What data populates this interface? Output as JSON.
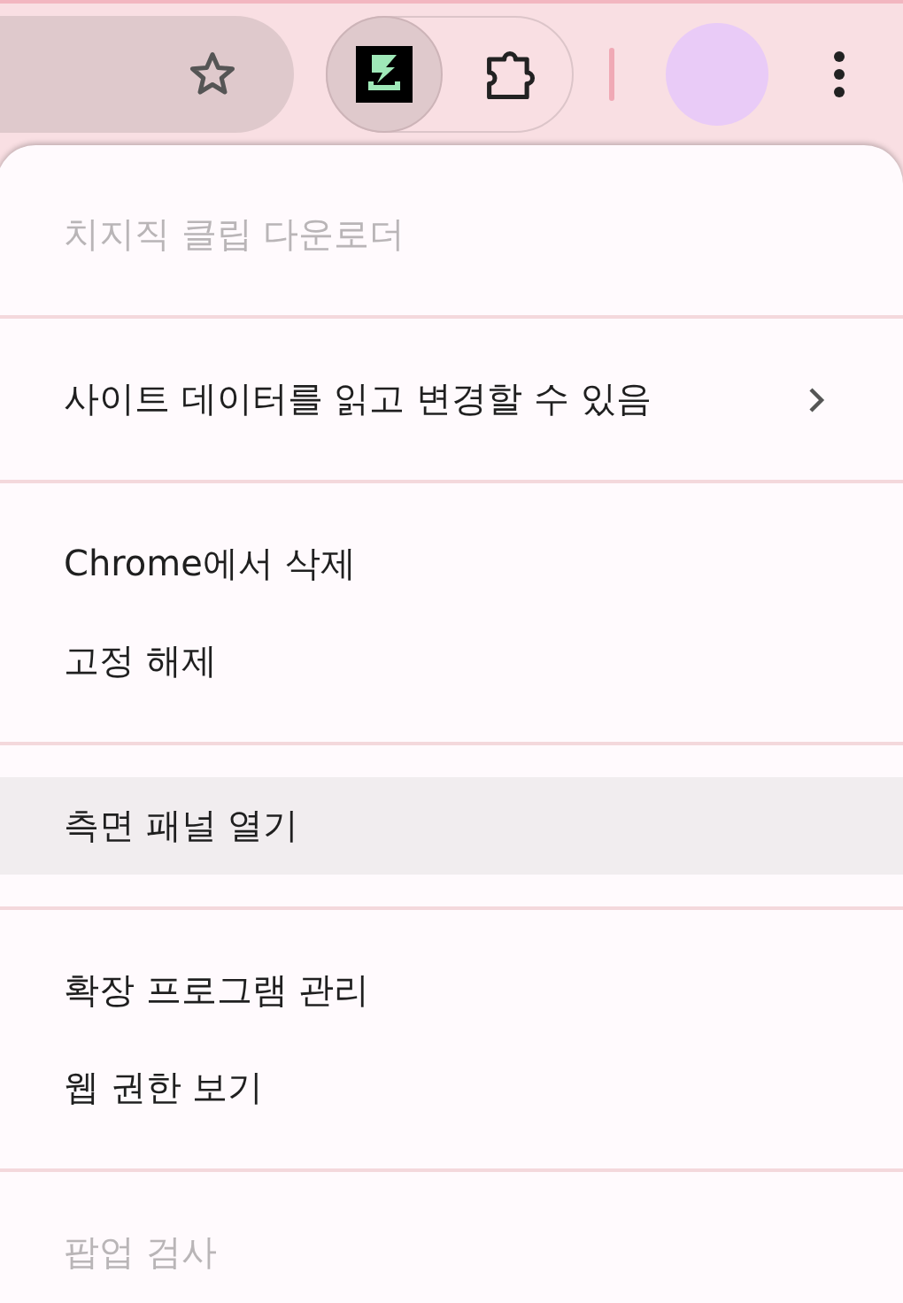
{
  "toolbar": {
    "pinned_extension_active": true
  },
  "menu": {
    "sections": [
      {
        "items": [
          {
            "label": "치지직 클립 다운로더",
            "kind": "header",
            "disabled": true,
            "highlighted": false
          }
        ]
      },
      {
        "items": [
          {
            "label": "사이트 데이터를 읽고 변경할 수 있음",
            "kind": "submenu",
            "disabled": false,
            "highlighted": false
          }
        ]
      },
      {
        "items": [
          {
            "label": "Chrome에서 삭제",
            "kind": "action",
            "disabled": false,
            "highlighted": false
          },
          {
            "label": "고정 해제",
            "kind": "action",
            "disabled": false,
            "highlighted": false
          }
        ]
      },
      {
        "items": [
          {
            "label": "측면 패널 열기",
            "kind": "action",
            "disabled": false,
            "highlighted": true
          }
        ]
      },
      {
        "items": [
          {
            "label": "확장 프로그램 관리",
            "kind": "action",
            "disabled": false,
            "highlighted": false
          },
          {
            "label": "웹 권한 보기",
            "kind": "action",
            "disabled": false,
            "highlighted": false
          }
        ]
      },
      {
        "items": [
          {
            "label": "팝업 검사",
            "kind": "action",
            "disabled": true,
            "highlighted": false
          }
        ]
      }
    ]
  }
}
